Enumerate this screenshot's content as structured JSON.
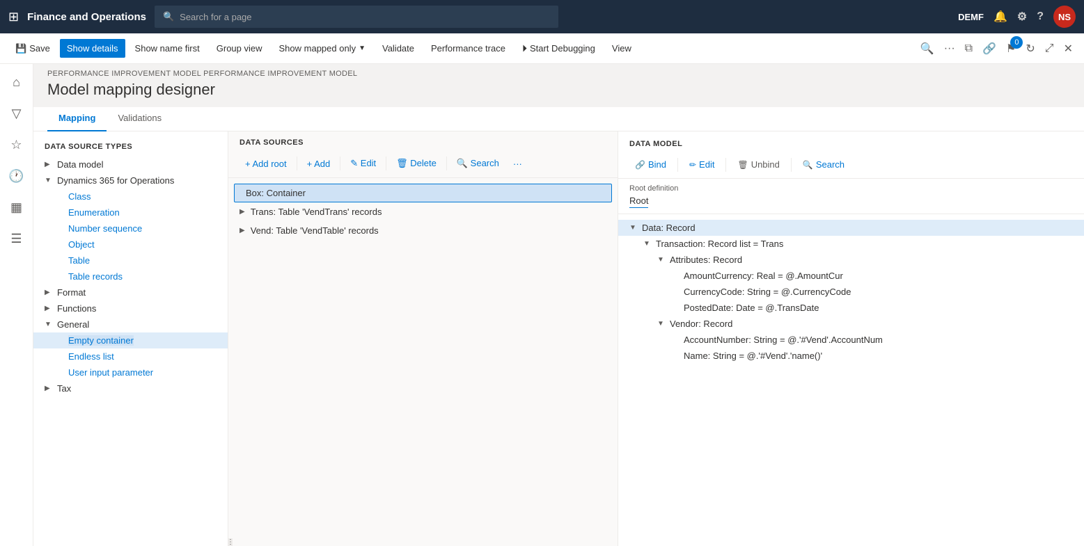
{
  "topnav": {
    "app_title": "Finance and Operations",
    "search_placeholder": "Search for a page",
    "user_label": "DEMF",
    "user_avatar": "NS"
  },
  "commandbar": {
    "save_label": "Save",
    "show_details_label": "Show details",
    "show_name_first_label": "Show name first",
    "group_view_label": "Group view",
    "show_mapped_only_label": "Show mapped only",
    "validate_label": "Validate",
    "performance_trace_label": "Performance trace",
    "start_debugging_label": "Start Debugging",
    "view_label": "View"
  },
  "breadcrumb": "PERFORMANCE IMPROVEMENT MODEL  PERFORMANCE IMPROVEMENT MODEL",
  "page_title": "Model mapping designer",
  "tabs": [
    {
      "label": "Mapping",
      "active": true
    },
    {
      "label": "Validations",
      "active": false
    }
  ],
  "ds_types": {
    "header": "DATA SOURCE TYPES",
    "items": [
      {
        "label": "Data model",
        "indent": 0,
        "expanded": false,
        "chevron": "▶"
      },
      {
        "label": "Dynamics 365 for Operations",
        "indent": 0,
        "expanded": true,
        "chevron": "▼"
      },
      {
        "label": "Class",
        "indent": 1,
        "expanded": false,
        "chevron": ""
      },
      {
        "label": "Enumeration",
        "indent": 1,
        "expanded": false,
        "chevron": ""
      },
      {
        "label": "Number sequence",
        "indent": 1,
        "expanded": false,
        "chevron": ""
      },
      {
        "label": "Object",
        "indent": 1,
        "expanded": false,
        "chevron": ""
      },
      {
        "label": "Table",
        "indent": 1,
        "expanded": false,
        "chevron": ""
      },
      {
        "label": "Table records",
        "indent": 1,
        "expanded": false,
        "chevron": "",
        "selected": false
      },
      {
        "label": "Format",
        "indent": 0,
        "expanded": false,
        "chevron": "▶"
      },
      {
        "label": "Functions",
        "indent": 0,
        "expanded": false,
        "chevron": "▶"
      },
      {
        "label": "General",
        "indent": 0,
        "expanded": true,
        "chevron": "▼"
      },
      {
        "label": "Empty container",
        "indent": 1,
        "expanded": false,
        "chevron": "",
        "selected": true
      },
      {
        "label": "Endless list",
        "indent": 1,
        "expanded": false,
        "chevron": ""
      },
      {
        "label": "User input parameter",
        "indent": 1,
        "expanded": false,
        "chevron": ""
      },
      {
        "label": "Tax",
        "indent": 0,
        "expanded": false,
        "chevron": "▶"
      }
    ]
  },
  "data_sources": {
    "header": "DATA SOURCES",
    "toolbar": {
      "add_root_label": "+ Add root",
      "add_label": "+ Add",
      "edit_label": "✎ Edit",
      "delete_label": "🗑 Delete",
      "search_label": "🔍 Search",
      "more_label": "···"
    },
    "items": [
      {
        "label": "Box: Container",
        "selected": true,
        "indent": 0,
        "chevron": ""
      },
      {
        "label": "Trans: Table 'VendTrans' records",
        "selected": false,
        "indent": 0,
        "chevron": "▶"
      },
      {
        "label": "Vend: Table 'VendTable' records",
        "selected": false,
        "indent": 0,
        "chevron": "▶"
      }
    ]
  },
  "data_model": {
    "header": "DATA MODEL",
    "toolbar": {
      "bind_label": "Bind",
      "edit_label": "Edit",
      "unbind_label": "Unbind",
      "search_label": "Search"
    },
    "root_definition_label": "Root definition",
    "root_value": "Root",
    "items": [
      {
        "label": "Data: Record",
        "indent": 0,
        "expanded": true,
        "chevron": "▼",
        "selected": true
      },
      {
        "label": "Transaction: Record list = Trans",
        "indent": 1,
        "expanded": true,
        "chevron": "▼",
        "selected": false
      },
      {
        "label": "Attributes: Record",
        "indent": 2,
        "expanded": true,
        "chevron": "▼",
        "selected": false
      },
      {
        "label": "AmountCurrency: Real = @.AmountCur",
        "indent": 3,
        "expanded": false,
        "chevron": "",
        "selected": false
      },
      {
        "label": "CurrencyCode: String = @.CurrencyCode",
        "indent": 3,
        "expanded": false,
        "chevron": "",
        "selected": false
      },
      {
        "label": "PostedDate: Date = @.TransDate",
        "indent": 3,
        "expanded": false,
        "chevron": "",
        "selected": false
      },
      {
        "label": "Vendor: Record",
        "indent": 2,
        "expanded": true,
        "chevron": "▼",
        "selected": false
      },
      {
        "label": "AccountNumber: String = @.'#Vend'.AccountNum",
        "indent": 3,
        "expanded": false,
        "chevron": "",
        "selected": false
      },
      {
        "label": "Name: String = @.'#Vend'.'name()'",
        "indent": 3,
        "expanded": false,
        "chevron": "",
        "selected": false
      }
    ]
  }
}
